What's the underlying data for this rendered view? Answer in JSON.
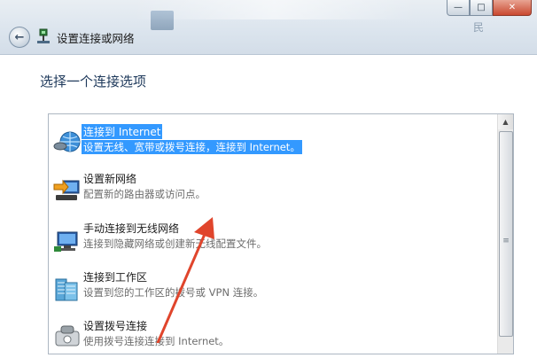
{
  "window": {
    "background_text": "民",
    "caption": {
      "minimize": "—",
      "maximize": "□",
      "close": "✕"
    }
  },
  "nav": {
    "back_icon": "back-arrow-icon",
    "title": "设置连接或网络"
  },
  "main": {
    "heading": "选择一个连接选项",
    "options": [
      {
        "title": "连接到 Internet",
        "desc": "设置无线、宽带或拨号连接，连接到 Internet。",
        "icon": "globe-network-icon",
        "selected": true
      },
      {
        "title": "设置新网络",
        "desc": "配置新的路由器或访问点。",
        "icon": "router-setup-icon",
        "selected": false
      },
      {
        "title": "手动连接到无线网络",
        "desc": "连接到隐藏网络或创建新无线配置文件。",
        "icon": "wireless-monitor-icon",
        "selected": false
      },
      {
        "title": "连接到工作区",
        "desc": "设置到您的工作区的拨号或 VPN 连接。",
        "icon": "workplace-building-icon",
        "selected": false
      },
      {
        "title": "设置拨号连接",
        "desc": "使用拨号连接连接到 Internet。",
        "icon": "dialup-phone-icon",
        "selected": false
      }
    ]
  },
  "colors": {
    "selection": "#3399ff",
    "heading": "#1e395b",
    "annotation_arrow": "#e0452c"
  }
}
